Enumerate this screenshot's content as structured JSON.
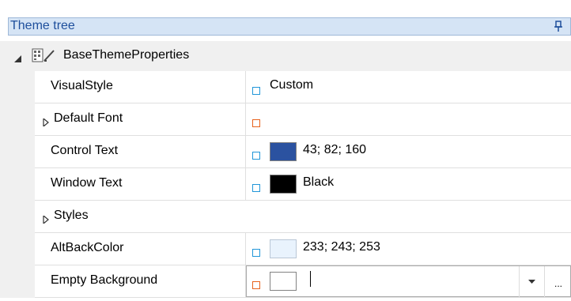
{
  "panel": {
    "title": "Theme tree"
  },
  "category": {
    "label": "BaseThemeProperties",
    "icon": "property-sheet-icon"
  },
  "properties": [
    {
      "name": "VisualStyle",
      "value": "Custom",
      "marker": "blue",
      "expandable": false
    },
    {
      "name": "Default Font",
      "value": "",
      "marker": "orange",
      "expandable": true
    },
    {
      "name": "Control Text",
      "value": "43; 82; 160",
      "marker": "blue",
      "swatch": "#2b52a0"
    },
    {
      "name": "Window Text",
      "value": "Black",
      "marker": "blue",
      "swatch": "#000000"
    },
    {
      "name": "Styles",
      "value": "",
      "expandable": true,
      "full_row": true
    },
    {
      "name": "AltBackColor",
      "value": "233; 243; 253",
      "marker": "blue",
      "swatch": "#e9f3fd"
    },
    {
      "name": "Empty Background",
      "value": "",
      "marker": "orange",
      "swatch": "#ffffff",
      "editing": true
    }
  ],
  "editor": {
    "dropdown_icon": "chevron-down-icon",
    "ellipsis_label": "..."
  },
  "colors": {
    "header_bg": "#d5e4f5",
    "header_text": "#1e4f9c",
    "marker_blue": "#2196d9",
    "marker_orange": "#e8621c"
  }
}
